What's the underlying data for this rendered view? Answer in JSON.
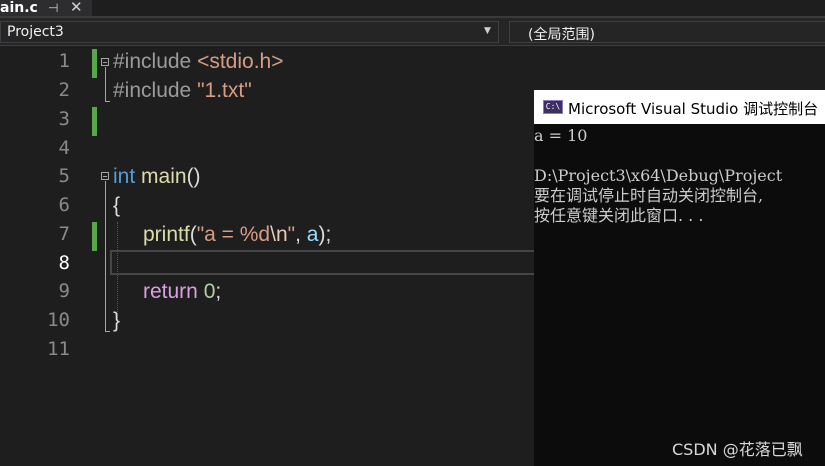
{
  "tab": {
    "title": "ain.c",
    "pin_glyph": "⊣",
    "close_glyph": "✕"
  },
  "navbar": {
    "project": "Project3",
    "scope": "(全局范围)"
  },
  "editor": {
    "line_numbers": [
      "1",
      "2",
      "3",
      "4",
      "5",
      "6",
      "7",
      "8",
      "9",
      "10",
      "11"
    ],
    "current_line": "8",
    "code": {
      "l1_directive": "#include",
      "l1_header": "<stdio.h>",
      "l2_directive": "#include",
      "l2_file": "\"1.txt\"",
      "l5_type": "int",
      "l5_name": "main",
      "l5_parens": "()",
      "l6_brace": "{",
      "l7_fn": "printf",
      "l7_open": "(",
      "l7_str_a": "\"a = %d",
      "l7_esc": "\\n",
      "l7_str_b": "\"",
      "l7_comma": ", ",
      "l7_arg": "a",
      "l7_close": ");",
      "l9_kw": "return",
      "l9_num": "0",
      "l9_semi": ";",
      "l10_brace": "}"
    }
  },
  "console": {
    "icon_text": "C:\\",
    "title": "Microsoft Visual Studio 调试控制台",
    "lines": [
      "a = 10",
      "",
      "D:\\Project3\\x64\\Debug\\Project",
      "要在调试停止时自动关闭控制台,",
      "按任意键关闭此窗口. . ."
    ]
  },
  "watermark": "CSDN @花落已飘"
}
